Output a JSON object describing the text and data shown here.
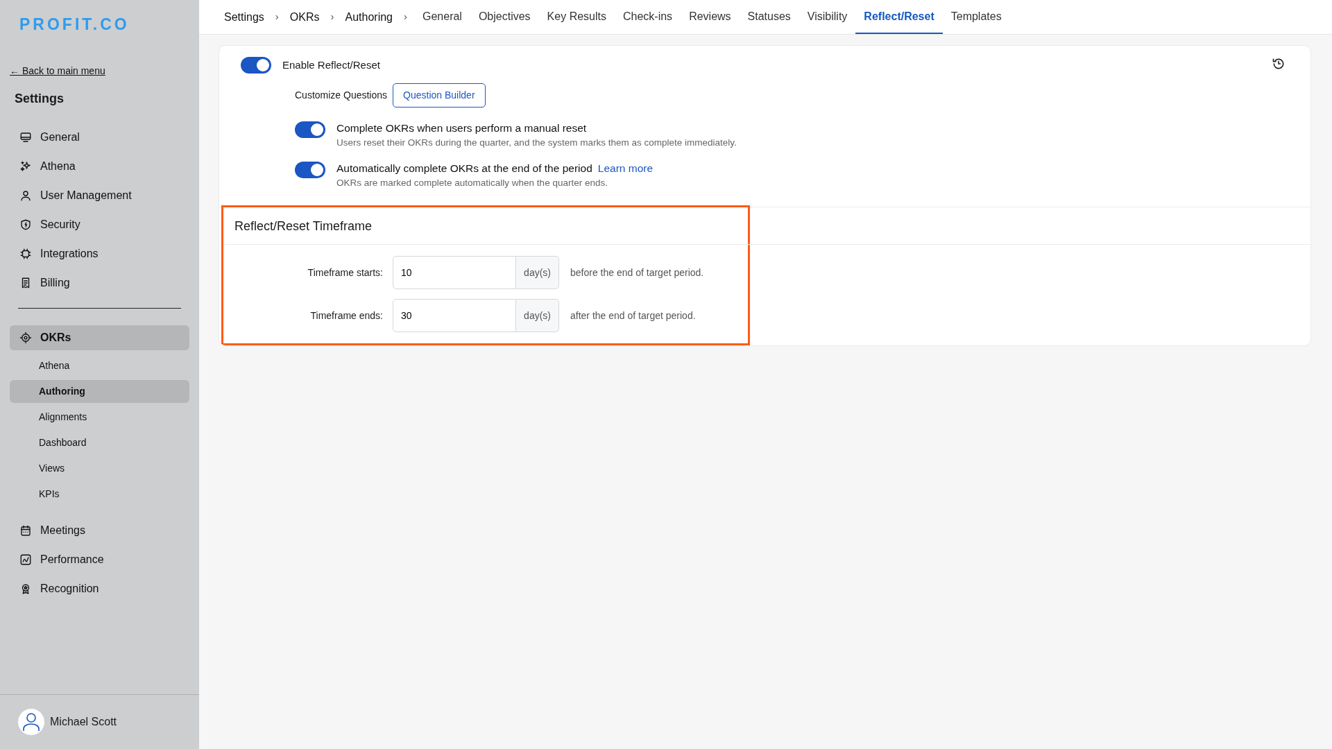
{
  "sidebar": {
    "logo": "PROFIT.CO",
    "back_link": "← Back to main menu",
    "heading": "Settings",
    "items": [
      {
        "label": "General",
        "selected": false
      },
      {
        "label": "Athena",
        "selected": false
      },
      {
        "label": "User Management",
        "selected": false
      },
      {
        "label": "Security",
        "selected": false
      },
      {
        "label": "Integrations",
        "selected": false
      },
      {
        "label": "Billing",
        "selected": false
      }
    ],
    "modules": [
      {
        "label": "OKRs",
        "selected": true,
        "children": [
          {
            "label": "Athena",
            "selected": false
          },
          {
            "label": "Authoring",
            "selected": true
          },
          {
            "label": "Alignments",
            "selected": false
          },
          {
            "label": "Dashboard",
            "selected": false
          },
          {
            "label": "Views",
            "selected": false
          },
          {
            "label": "KPIs",
            "selected": false
          }
        ]
      },
      {
        "label": "Meetings",
        "selected": false
      },
      {
        "label": "Performance",
        "selected": false
      },
      {
        "label": "Recognition",
        "selected": false
      }
    ],
    "user": {
      "name": "Michael Scott"
    }
  },
  "breadcrumb": {
    "items": [
      "Settings",
      "OKRs",
      "Authoring"
    ],
    "separator": "›"
  },
  "tabs": [
    {
      "label": "General",
      "selected": false
    },
    {
      "label": "Objectives",
      "selected": false
    },
    {
      "label": "Key Results",
      "selected": false
    },
    {
      "label": "Check-ins",
      "selected": false
    },
    {
      "label": "Reviews",
      "selected": false
    },
    {
      "label": "Statuses",
      "selected": false
    },
    {
      "label": "Visibility",
      "selected": false
    },
    {
      "label": "Reflect/Reset",
      "selected": true
    },
    {
      "label": "Templates",
      "selected": false
    }
  ],
  "enable_toggle": {
    "label": "Enable Reflect/Reset",
    "on": true
  },
  "customize": {
    "label": "Customize Questions",
    "button": "Question Builder"
  },
  "options": [
    {
      "title": "Complete OKRs when users perform a manual reset",
      "description": "Users reset their OKRs during the quarter, and the system marks them as complete immediately.",
      "on": true
    },
    {
      "title": "Automatically complete OKRs at the end of the period",
      "link": "Learn more",
      "description": "OKRs are marked complete automatically when the quarter ends.",
      "on": true
    }
  ],
  "timeframe": {
    "title": "Reflect/Reset Timeframe",
    "highlighted": true,
    "fields": [
      {
        "label": "Timeframe starts:",
        "value": "10",
        "unit": "day(s)",
        "suffix": "before the end of target period."
      },
      {
        "label": "Timeframe ends:",
        "value": "30",
        "unit": "day(s)",
        "suffix": "after the end of target period."
      }
    ]
  }
}
